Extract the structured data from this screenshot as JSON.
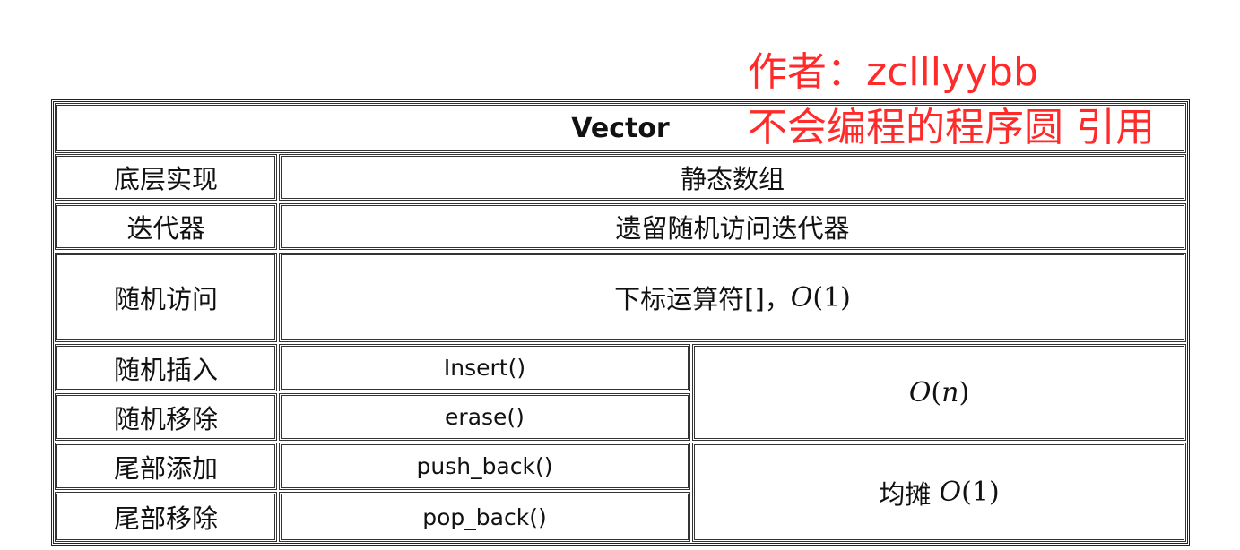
{
  "table": {
    "title": "Vector",
    "rows": [
      {
        "label": "底层实现",
        "value": "静态数组"
      },
      {
        "label": "迭代器",
        "value": "遗留随机访问迭代器"
      },
      {
        "label": "随机访问",
        "value_text": "下标运算符[]，",
        "value_math_var": "O",
        "value_math_arg": "(1)"
      }
    ],
    "ops": [
      {
        "label": "随机插入",
        "method": "Insert()"
      },
      {
        "label": "随机移除",
        "method": "erase()"
      },
      {
        "label": "尾部添加",
        "method": "push_back()"
      },
      {
        "label": "尾部移除",
        "method": "pop_back()"
      }
    ],
    "complexity_random": {
      "var": "O",
      "open": "(",
      "arg": "n",
      "close": ")"
    },
    "complexity_tail": {
      "prefix": "均摊 ",
      "var": "O",
      "arg": "(1)"
    }
  },
  "watermark": {
    "author": "作者：zclllyybb",
    "credit": "不会编程的程序圆 引用",
    "color": "#ff2a2a"
  }
}
